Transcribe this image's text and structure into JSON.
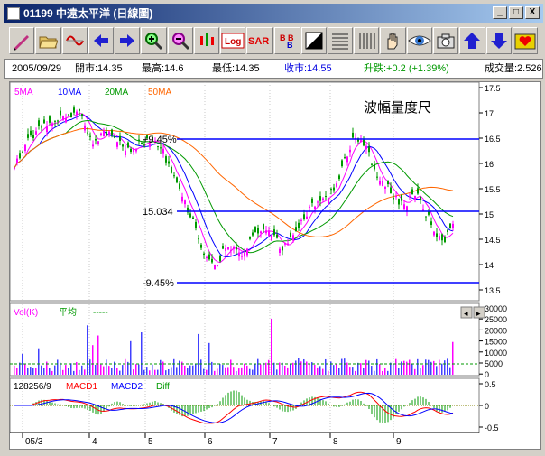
{
  "window": {
    "title": "01199  中遠太平洋  (日線圖)",
    "controls": [
      "_",
      "□",
      "X"
    ]
  },
  "toolbar": {
    "items": [
      "pencil-icon",
      "open-folder-icon",
      "wave-icon",
      "arrow-left-icon",
      "arrow-right-icon",
      "zoom-in-icon",
      "zoom-out-icon",
      "candlestick-icon",
      "log-icon",
      "sar-icon",
      "bb-icon",
      "contrast-icon",
      "grid-horizontal-icon",
      "grid-vertical-icon",
      "hand-icon",
      "eye-icon",
      "camera-icon",
      "arrow-up-icon",
      "arrow-down-icon",
      "heart-icon"
    ],
    "log_label": "Log",
    "sar_label": "SAR",
    "bb_label": "B B"
  },
  "info": {
    "date": "2005/09/29",
    "open": "開市:14.35",
    "high": "最高:14.6",
    "low": "最低:14.35",
    "close": "收市:14.55",
    "change": "升跌:+0.2 (+1.39%)",
    "volume": "成交量:2.526"
  },
  "price_panel": {
    "ma_legend": [
      {
        "label": "5MA",
        "color": "#ff00ff"
      },
      {
        "label": "10MA",
        "color": "#0000ff"
      },
      {
        "label": "20MA",
        "color": "#009900"
      },
      {
        "label": "50MA",
        "color": "#ff6600"
      }
    ],
    "ruler_title": "波幅量度尺",
    "ruler_upper": "+9.45%",
    "ruler_mid": "15.034",
    "ruler_lower": "-9.45%",
    "y_ticks": [
      "17.5",
      "17",
      "16.5",
      "16",
      "15.5",
      "15",
      "14.5",
      "14",
      "13.5"
    ]
  },
  "volume_panel": {
    "label": "Vol(K)",
    "avg_label": "平均",
    "avg_dash": "-----",
    "y_ticks": [
      "30000",
      "25000",
      "20000",
      "15000",
      "10000",
      "5000",
      "0"
    ]
  },
  "macd_panel": {
    "value": "128256/9",
    "labels": [
      {
        "label": "MACD1",
        "color": "#ff0000"
      },
      {
        "label": "MACD2",
        "color": "#0000ff"
      },
      {
        "label": "Diff",
        "color": "#009900"
      }
    ],
    "y_ticks": [
      "0.5",
      "0",
      "-0.5"
    ]
  },
  "x_axis": {
    "labels": [
      "05/3",
      "4",
      "5",
      "6",
      "7",
      "8",
      "9"
    ]
  },
  "colors": {
    "up": "#ff00ff",
    "down": "#009900",
    "ruler": "#0000ff",
    "ma5": "#ff00ff",
    "ma10": "#0000ff",
    "ma20": "#009900",
    "ma50": "#ff6600",
    "macd1": "#ff0000",
    "macd2": "#0000ff"
  }
}
